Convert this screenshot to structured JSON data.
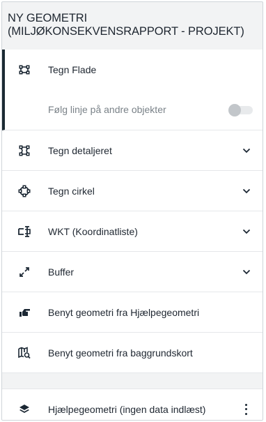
{
  "panel": {
    "title_line1": "NY GEOMETRI",
    "title_line2": "(MILJØKONSEKVENSRAPPORT - PROJEKT)"
  },
  "items": [
    {
      "label": "Tegn Flade",
      "icon": "draw-polygon-icon"
    },
    {
      "label": "Tegn detaljeret",
      "icon": "draw-detailed-icon"
    },
    {
      "label": "Tegn cirkel",
      "icon": "draw-circle-icon"
    },
    {
      "label": "WKT (Koordinatliste)",
      "icon": "wkt-coordinates-icon"
    },
    {
      "label": "Buffer",
      "icon": "buffer-expand-icon"
    },
    {
      "label": "Benyt geometri fra Hjælpegeometri",
      "icon": "hand-pointer-icon"
    },
    {
      "label": "Benyt geometri fra baggrundskort",
      "icon": "map-search-icon"
    }
  ],
  "snap_option": {
    "label": "Følg linje på andre objekter",
    "enabled": false
  },
  "helper_layer": {
    "label": "Hjælpegeometri (ingen data indlæst)",
    "icon": "layers-icon"
  },
  "colors": {
    "accent": "#1b2a33",
    "text": "#1e2630",
    "muted": "#7a8288",
    "panel_bg": "#f2f3f4"
  }
}
